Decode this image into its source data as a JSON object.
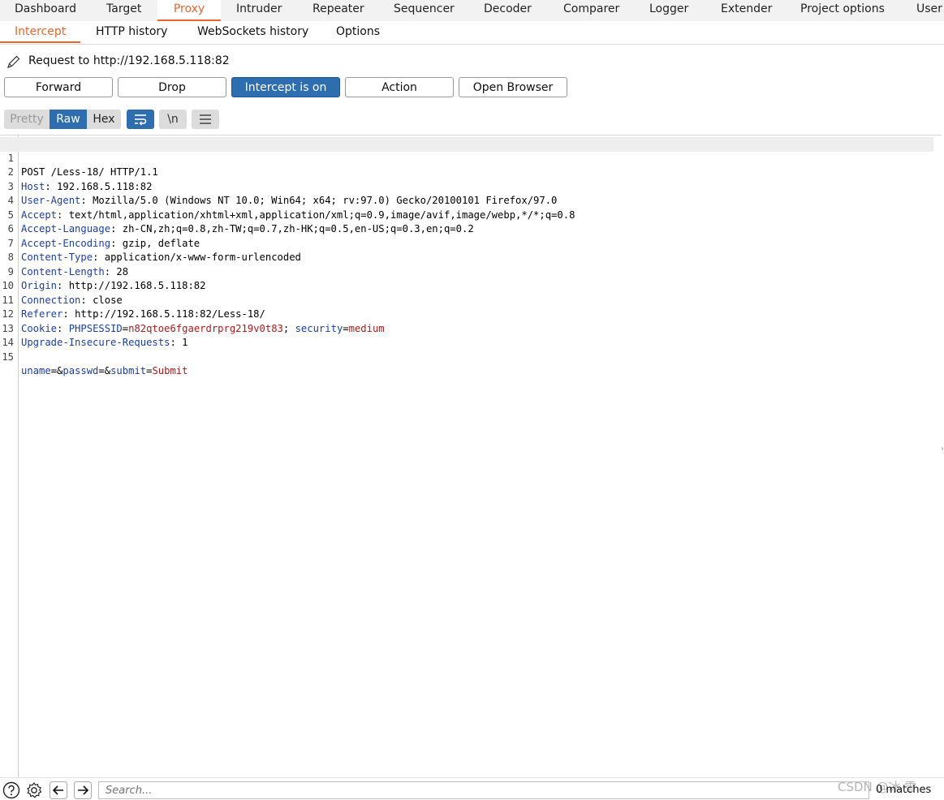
{
  "main_tabs": [
    "Dashboard",
    "Target",
    "Proxy",
    "Intruder",
    "Repeater",
    "Sequencer",
    "Decoder",
    "Comparer",
    "Logger",
    "Extender",
    "Project options",
    "User o"
  ],
  "active_main_tab": "Proxy",
  "sub_tabs": [
    "Intercept",
    "HTTP history",
    "WebSockets history",
    "Options"
  ],
  "active_sub_tab": "Intercept",
  "request_label": "Request to http://192.168.5.118:82",
  "buttons": {
    "forward": "Forward",
    "drop": "Drop",
    "intercept": "Intercept is on",
    "action": "Action",
    "open_browser": "Open Browser"
  },
  "view_modes": {
    "pretty": "Pretty",
    "raw": "Raw",
    "hex": "Hex"
  },
  "active_view": "Raw",
  "newline_toggle": "\\n",
  "editor_lines": [
    {
      "n": "1",
      "text": "POST /Less-18/ HTTP/1.1"
    },
    {
      "n": "2",
      "key": "Host",
      "value": "192.168.5.118:82"
    },
    {
      "n": "3",
      "key": "User-Agent",
      "value": "Mozilla/5.0 (Windows NT 10.0; Win64; x64; rv:97.0) Gecko/20100101 Firefox/97.0"
    },
    {
      "n": "4",
      "key": "Accept",
      "value": "text/html,application/xhtml+xml,application/xml;q=0.9,image/avif,image/webp,*/*;q=0.8"
    },
    {
      "n": "5",
      "key": "Accept-Language",
      "value": "zh-CN,zh;q=0.8,zh-TW;q=0.7,zh-HK;q=0.5,en-US;q=0.3,en;q=0.2"
    },
    {
      "n": "6",
      "key": "Accept-Encoding",
      "value": "gzip, deflate"
    },
    {
      "n": "7",
      "key": "Content-Type",
      "value": "application/x-www-form-urlencoded"
    },
    {
      "n": "8",
      "key": "Content-Length",
      "value": "28"
    },
    {
      "n": "9",
      "key": "Origin",
      "value": "http://192.168.5.118:82"
    },
    {
      "n": "10",
      "key": "Connection",
      "value": "close"
    },
    {
      "n": "11",
      "key": "Referer",
      "value": "http://192.168.5.118:82/Less-18/"
    },
    {
      "n": "12",
      "key": "Cookie",
      "cookies": [
        {
          "name": "PHPSESSID",
          "value": "n82qtoe6fgaerdrprg219v0t83"
        },
        {
          "name": "security",
          "value": "medium"
        }
      ]
    },
    {
      "n": "13",
      "key": "Upgrade-Insecure-Requests",
      "value": "1"
    },
    {
      "n": "14",
      "text": ""
    },
    {
      "n": "15",
      "params": [
        {
          "name": "uname",
          "value": ""
        },
        {
          "name": "passwd",
          "value": ""
        },
        {
          "name": "submit",
          "value": "Submit"
        }
      ]
    }
  ],
  "search": {
    "placeholder": "Search..."
  },
  "matches": "0 matches",
  "watermark": "CSDN @冰 雪"
}
